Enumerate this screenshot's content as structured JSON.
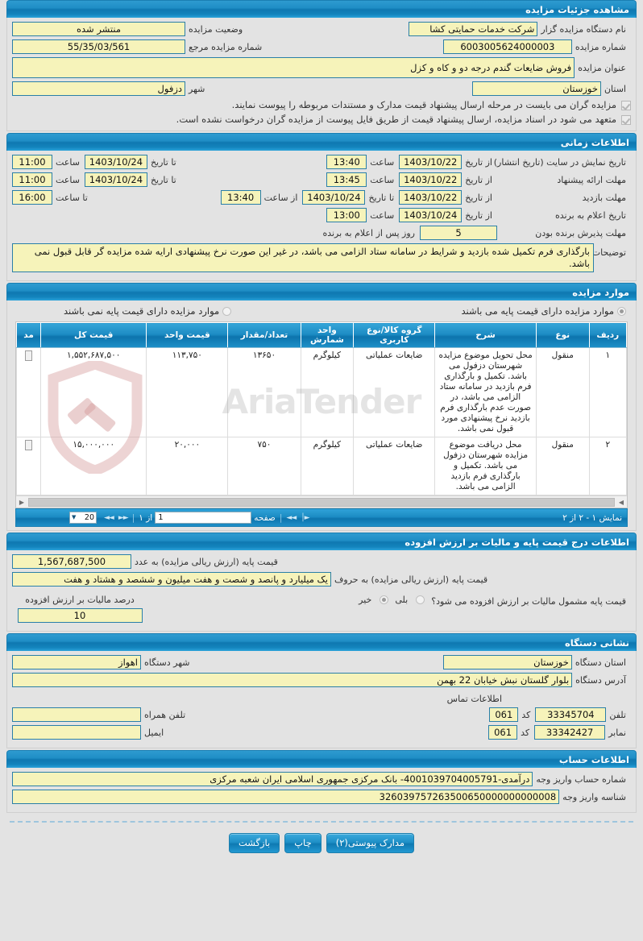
{
  "page": {
    "title": "مشاهده جزئیات مزایده"
  },
  "details": {
    "org_label": "نام دستگاه مزایده گزار",
    "org_value": "شرکت خدمات حمایتی کشا",
    "status_label": "وضعیت مزایده",
    "status_value": "منتشر شده",
    "number_label": "شماره مزایده",
    "number_value": "6003005624000003",
    "ref_number_label": "شماره مزایده مرجع",
    "ref_number_value": "55/35/03/561",
    "title_label": "عنوان مزایده",
    "title_value": "فروش ضایعات گندم درجه دو و کاه و کزل",
    "province_label": "استان",
    "province_value": "خوزستان",
    "city_label": "شهر",
    "city_value": "دزفول",
    "check1": "مزایده گران می بایست در مرحله ارسال پیشنهاد قیمت مدارک و مستندات مربوطه را پیوست نمایند.",
    "check2": "متعهد می شود در اسناد مزایده، ارسال پیشنهاد قیمت از طریق فایل پیوست از مزایده گران درخواست نشده است."
  },
  "timing": {
    "heading": "اطلاعات زمانی",
    "rows": [
      {
        "label": "تاریخ نمایش در سایت (تاریخ انتشار)",
        "from_label": "از تاریخ",
        "from_date": "1403/10/22",
        "time_label_1": "ساعت",
        "time_1": "13:40",
        "to_label": "تا تاریخ",
        "to_date": "1403/10/24",
        "time_label_2": "ساعت",
        "time_2": "11:00"
      },
      {
        "label": "مهلت ارائه پیشنهاد",
        "from_label": "از تاریخ",
        "from_date": "1403/10/22",
        "time_label_1": "ساعت",
        "time_1": "13:45",
        "to_label": "تا تاریخ",
        "to_date": "1403/10/24",
        "time_label_2": "ساعت",
        "time_2": "11:00"
      },
      {
        "label": "مهلت بازدید",
        "from_label": "از تاریخ",
        "from_date": "1403/10/22",
        "to_label": "تا تاریخ",
        "to_date": "1403/10/24",
        "time_label_1": "از ساعت",
        "time_1": "13:40",
        "time_label_2": "تا ساعت",
        "time_2": "16:00"
      }
    ],
    "winner_label": "تاریخ اعلام به برنده",
    "winner_from_label": "از تاریخ",
    "winner_date": "1403/10/24",
    "winner_time_label": "ساعت",
    "winner_time": "13:00",
    "accept_label": "مهلت پذیرش برنده بودن",
    "accept_days": "5",
    "accept_suffix": "روز پس از اعلام به برنده",
    "notes_label": "توضیحات",
    "notes_value": "بارگذاری فرم تکمیل شده بازدید و شرایط در سامانه ستاد الزامی می باشد، در غیر این صورت نرخ پیشنهادی ارایه شده مزایده گر قابل قبول نمی باشد."
  },
  "items": {
    "heading": "موارد مزایده",
    "radio_with_base": "موارد مزایده دارای قیمت پایه می باشند",
    "radio_without_base": "موارد مزایده دارای قیمت پایه نمی باشند",
    "columns": [
      "ردیف",
      "نوع",
      "شرح",
      "گروه کالا/نوع کاربری",
      "واحد شمارش",
      "تعداد/مقدار",
      "قیمت واحد",
      "قیمت کل",
      "مد"
    ],
    "rows": [
      {
        "index": "۱",
        "type": "منقول",
        "description": "محل تحویل موضوع مزایده شهرستان دزفول می باشد. تکمیل و بارگذاری فرم بازدید در سامانه ستاد الزامی می باشد، در صورت عدم بارگذاری فرم بازدید نرخ پیشنهادی مورد قبول نمی باشد.",
        "group": "ضایعات عملیاتی",
        "unit": "کیلوگرم",
        "quantity": "۱۳۶۵۰",
        "unit_price": "۱۱۳,۷۵۰",
        "total_price": "۱,۵۵۲,۶۸۷,۵۰۰"
      },
      {
        "index": "۲",
        "type": "منقول",
        "description": "محل دریافت موضوع مزایده شهرستان دزفول می باشد. تکمیل و بارگذاری فرم بازدید الزامی می باشد.",
        "group": "ضایعات عملیاتی",
        "unit": "کیلوگرم",
        "quantity": "۷۵۰",
        "unit_price": "۲۰,۰۰۰",
        "total_price": "۱۵,۰۰۰,۰۰۰"
      }
    ],
    "pager": {
      "display_info": "نمایش ۱ - ۲ از ۲",
      "first_label": "◄◄",
      "prev_label": "►►",
      "page_label": "صفحه",
      "page_value": "1",
      "of_label": "از ۱",
      "next_label": "◄◄",
      "last_label": "►│",
      "page_size": "20"
    },
    "watermark": "AriaTender"
  },
  "price": {
    "heading": "اطلاعات درج قیمت پایه و مالیات بر ارزش افزوده",
    "base_number_label": "قیمت پایه (ارزش ریالی مزایده) به عدد",
    "base_number_value": "1,567,687,500",
    "base_words_label": "قیمت پایه (ارزش ریالی مزایده) به حروف",
    "base_words_value": "یک میلیارد و پانصد و شصت و هفت میلیون و ششصد و هشتاد و هفت",
    "vat_question": "قیمت پایه مشمول مالیات بر ارزش افزوده می شود؟",
    "vat_yes": "بلی",
    "vat_no": "خیر",
    "vat_percent_label": "درصد مالیات بر ارزش افزوده",
    "vat_percent_value": "10"
  },
  "address": {
    "heading": "نشانی دستگاه",
    "province_label": "استان دستگاه",
    "province_value": "خوزستان",
    "city_label": "شهر دستگاه",
    "city_value": "اهواز",
    "address_label": "آدرس دستگاه",
    "address_value": "بلوار گلستان نبش خیابان 22 بهمن",
    "contact_heading": "اطلاعات تماس",
    "phone_label": "تلفن",
    "phone_value": "33345704",
    "phone_code_label": "کد",
    "phone_code_value": "061",
    "mobile_label": "تلفن همراه",
    "mobile_value": "",
    "fax_label": "نمابر",
    "fax_value": "33342427",
    "fax_code_label": "کد",
    "fax_code_value": "061",
    "email_label": "ایمیل",
    "email_value": ""
  },
  "account": {
    "heading": "اطلاعات حساب",
    "account_label": "شماره حساب واریز وجه",
    "account_value": "درآمدی-4001039704005791- بانک مرکزی جمهوری اسلامی ایران شعبه مرکزی",
    "identifier_label": "شناسه واریز وجه",
    "identifier_value": "326039757263500650000000000008"
  },
  "footer": {
    "attachments_label": "مدارک پیوستی(۲)",
    "print_label": "چاپ",
    "back_label": "بازگشت"
  },
  "colors": {
    "header_blue": "#1f8ec6",
    "field_yellow": "#f6f3ba",
    "field_border": "#2a7fa8",
    "page_bg": "#e3e3e3"
  }
}
